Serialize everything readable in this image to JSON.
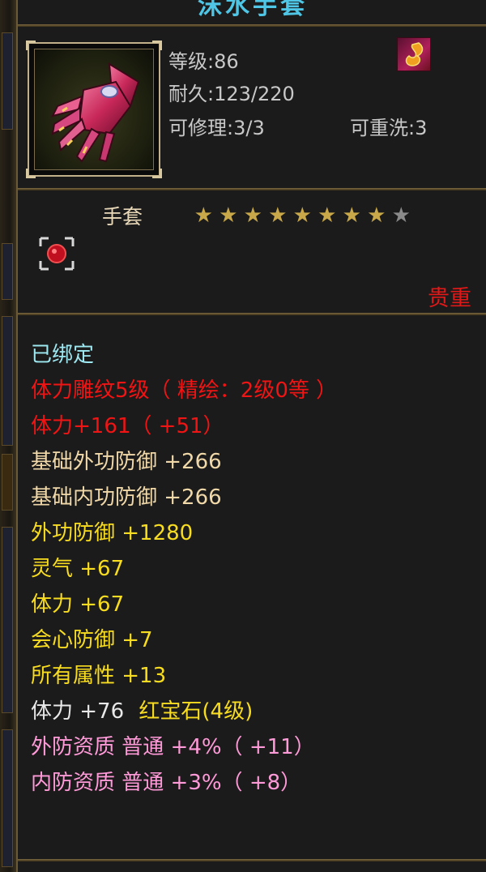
{
  "item": {
    "name": "沫水手套",
    "level_label": "等级:86",
    "durability_label": "耐久:123/220",
    "repairable_label": "可修理:3/3",
    "rewash_label": "可重洗:3",
    "type": "手套",
    "stars_filled": 8,
    "stars_total": 9,
    "rarity": "贵重"
  },
  "colors": {
    "title": "#4fc6e6",
    "bound": "#9ee8f2",
    "red": "#f01414",
    "base": "#f0d8a8",
    "yellow": "#f8dc20",
    "pink": "#ff9ad8",
    "star_gold": "#c9a84a",
    "star_gray": "#8a8a8a"
  },
  "icons": {
    "item": "gauntlet-icon",
    "school": "flame-emblem-icon",
    "gem": "red-gem-icon",
    "star": "star-icon"
  },
  "attributes": [
    {
      "text": "已绑定",
      "style": "cyan"
    },
    {
      "text": "体力雕纹5级（ 精绘：2级0等 ）",
      "style": "red"
    },
    {
      "text": "体力+161（ +51）",
      "style": "red"
    },
    {
      "text": "基础外功防御 +266",
      "style": "peach"
    },
    {
      "text": "基础内功防御 +266",
      "style": "peach"
    },
    {
      "text": "外功防御 +1280",
      "style": "yellow"
    },
    {
      "text": "灵气 +67",
      "style": "yellow"
    },
    {
      "text": "体力 +67",
      "style": "yellow"
    },
    {
      "text": "会心防御 +7",
      "style": "yellow"
    },
    {
      "text": "所有属性 +13",
      "style": "yellow"
    }
  ],
  "gem_line": {
    "stat": "体力 +76",
    "gem": "红宝石(4级)"
  },
  "quality_lines": [
    {
      "text": "外防资质 普通 +4%（ +11）"
    },
    {
      "text": "内防资质 普通 +3%（ +8）"
    }
  ]
}
